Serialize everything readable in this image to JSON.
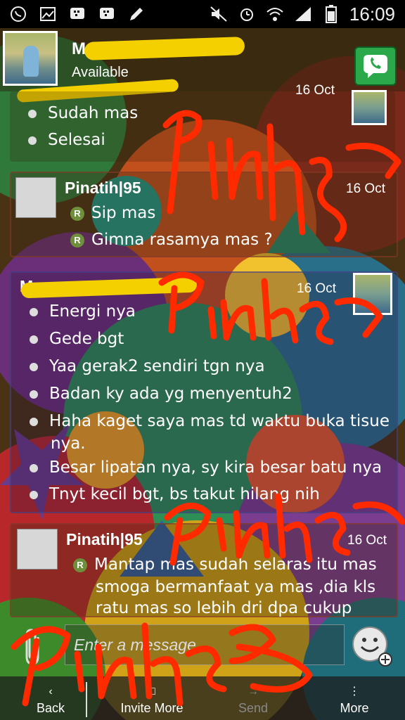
{
  "status_bar": {
    "time": "16:09",
    "left_icons": [
      "whatsapp-icon",
      "gallery-icon",
      "bbm-icon",
      "bbm-icon",
      "pencil-icon"
    ],
    "right_icons": [
      "mute-icon",
      "alarm-icon",
      "wifi-icon",
      "signal-icon",
      "battery-icon"
    ]
  },
  "header": {
    "contact_name": "M",
    "contact_status": "Available"
  },
  "conversation": {
    "block1": {
      "time": "16 Oct",
      "messages": [
        "Sudah mas",
        "Selesai"
      ]
    },
    "block2": {
      "sender": "Pinatih|95",
      "time": "16 Oct",
      "messages": [
        "Sip mas",
        "Gimna rasamya mas ?"
      ]
    },
    "block3": {
      "sender": "M",
      "time": "16 Oct",
      "messages": [
        "Energi nya",
        "Gede bgt",
        "Yaa gerak2 sendiri tgn nya",
        "Badan ky ada yg menyentuh2",
        "Haha kaget saya mas td waktu buka tisue",
        "nya.",
        "Besar lipatan nya, sy kira besar batu nya",
        "Tnyt kecil bgt, bs takut hilang nih"
      ]
    },
    "block4": {
      "sender": "Pinatih|95",
      "time": "16 Oct",
      "messages": [
        "Mantap mas sudah selaras itu mas",
        "smoga bermanfaat ya mas ,dia kls",
        "ratu mas so lebih dri dpa cukup"
      ]
    },
    "read_badge": "R"
  },
  "compose": {
    "placeholder": "Enter a message"
  },
  "bottom_bar": {
    "back": "Back",
    "invite_more": "Invite More",
    "send": "Send",
    "more": "More"
  },
  "watermark": {
    "texts": [
      "Pinatih|95",
      "Pinatih|95",
      "Pinatih|95",
      "Pinatih|95"
    ],
    "color": "#ff2a00"
  },
  "colors": {
    "redaction": "#f4d000",
    "call_button": "#2aa84a",
    "read_badge": "#6e8f3b"
  }
}
